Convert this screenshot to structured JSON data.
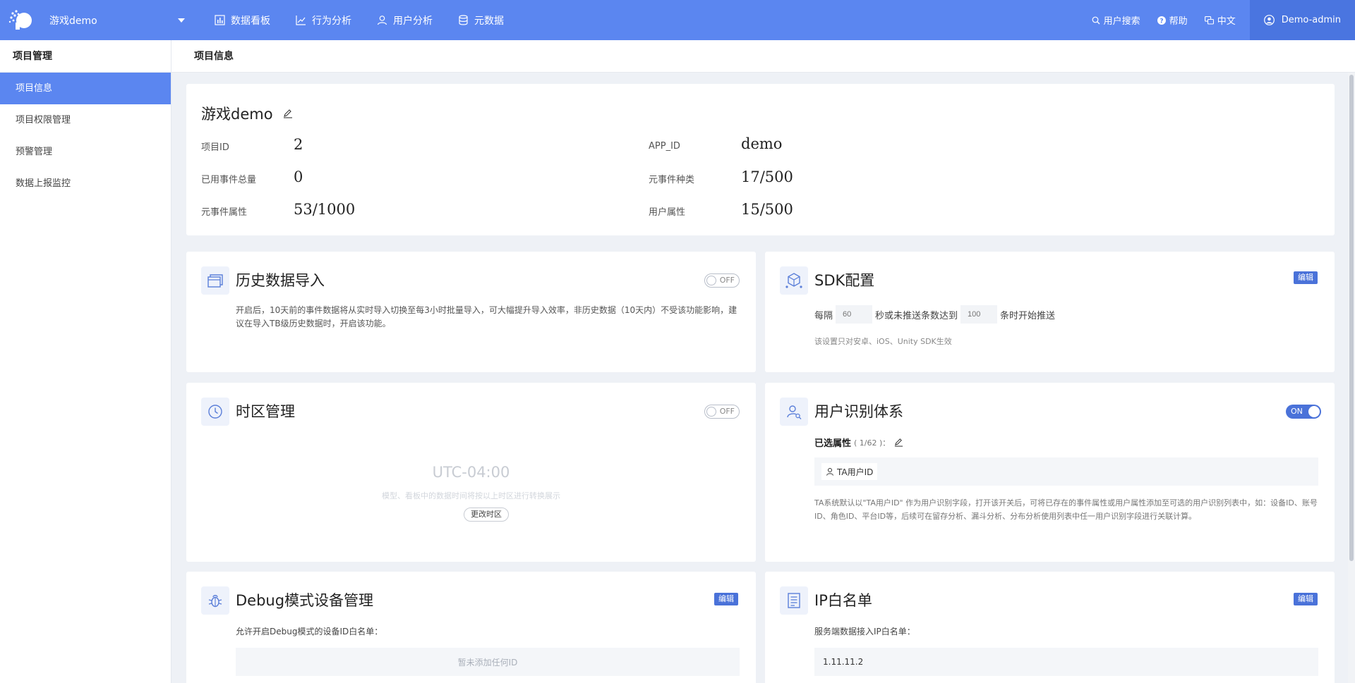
{
  "topbar": {
    "project_name": "游戏demo",
    "nav": [
      {
        "label": "数据看板",
        "icon": "bar-chart-icon"
      },
      {
        "label": "行为分析",
        "icon": "line-trend-icon"
      },
      {
        "label": "用户分析",
        "icon": "user-icon"
      },
      {
        "label": "元数据",
        "icon": "database-icon"
      }
    ],
    "right": {
      "search": "用户搜索",
      "help": "帮助",
      "language": "中文",
      "user": "Demo-admin"
    }
  },
  "sidebar": {
    "header": "项目管理",
    "items": [
      {
        "label": "项目信息",
        "active": true
      },
      {
        "label": "项目权限管理",
        "active": false
      },
      {
        "label": "预警管理",
        "active": false
      },
      {
        "label": "数据上报监控",
        "active": false
      }
    ]
  },
  "content": {
    "header": "项目信息"
  },
  "project_info": {
    "name": "游戏demo",
    "fields": [
      {
        "key": "项目ID",
        "value": "2"
      },
      {
        "key": "APP_ID",
        "value": "demo"
      },
      {
        "key": "已用事件总量",
        "value": "0"
      },
      {
        "key": "元事件种类",
        "value": "17/500"
      },
      {
        "key": "元事件属性",
        "value": "53/1000"
      },
      {
        "key": "用户属性",
        "value": "15/500"
      }
    ]
  },
  "history_import": {
    "title": "历史数据导入",
    "toggle": "OFF",
    "desc": "开启后，10天前的事件数据将从实时导入切换至每3小时批量导入，可大幅提升导入效率，非历史数据（10天内）不受该功能影响，建议在导入TB级历史数据时，开启该功能。"
  },
  "sdk_config": {
    "title": "SDK配置",
    "edit": "编辑",
    "prefix": "每隔",
    "interval_placeholder": "60",
    "middle": "秒或未推送条数达到",
    "count_placeholder": "100",
    "suffix": "条时开始推送",
    "note": "该设置只对安卓、iOS、Unity SDK生效"
  },
  "timezone": {
    "title": "时区管理",
    "toggle": "OFF",
    "value": "UTC-04:00",
    "desc": "模型、看板中的数据时间将按以上时区进行转换展示",
    "button": "更改时区"
  },
  "user_id_system": {
    "title": "用户识别体系",
    "toggle": "ON",
    "selected_label": "已选属性",
    "selected_count": "( 1/62 )：",
    "chip": "TA用户ID",
    "desc": "TA系统默认以\"TA用户ID\" 作为用户识别字段，打开该开关后，可将已存在的事件属性或用户属性添加至可选的用户识别列表中，如：设备ID、账号ID、角色ID、平台ID等，后续可在留存分析、漏斗分析、分布分析使用列表中任一用户识别字段进行关联计算。"
  },
  "debug_devices": {
    "title": "Debug模式设备管理",
    "edit": "编辑",
    "label": "允许开启Debug模式的设备ID白名单：",
    "empty": "暂未添加任何ID"
  },
  "ip_whitelist": {
    "title": "IP白名单",
    "edit": "编辑",
    "label": "服务端数据接入IP白名单：",
    "ip": "1.11.11.2"
  }
}
